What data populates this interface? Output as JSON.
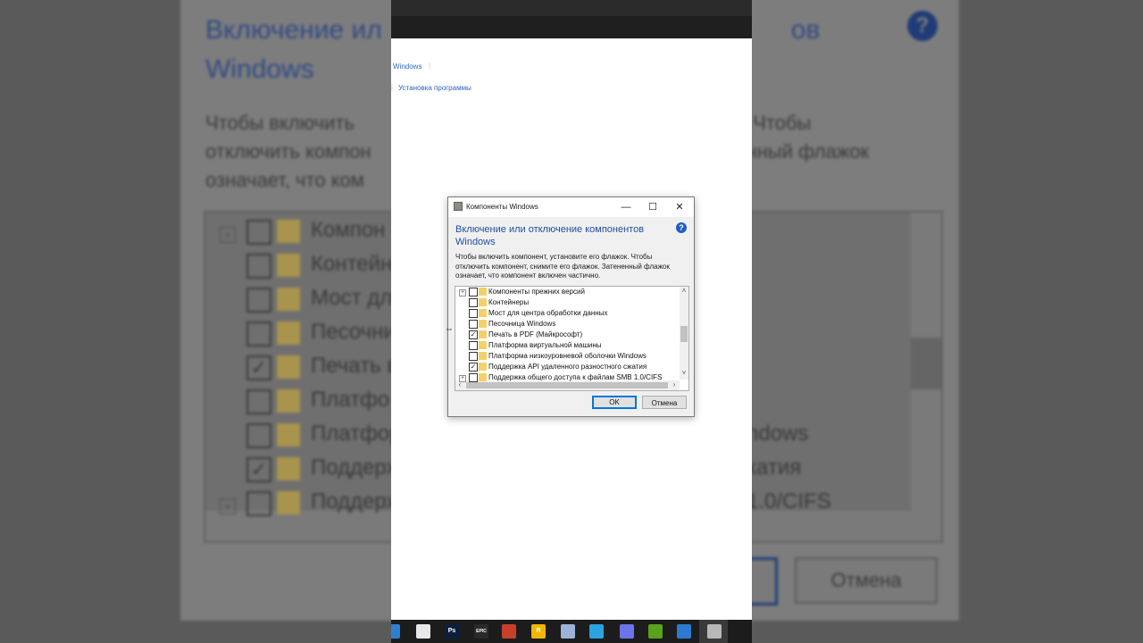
{
  "background": {
    "title": "Включение или отключение компонентов Windows",
    "title_left": "Включение ил",
    "title_right": "ов",
    "title_line2": "Windows",
    "desc_lines": [
      {
        "left": "Чтобы включить",
        "right": ". Чтобы"
      },
      {
        "left": "отключить компон",
        "right": "нный флажок"
      },
      {
        "left": "означает, что ком",
        "right": ""
      }
    ],
    "rows": [
      {
        "text_left": "Компон",
        "text_right": "",
        "checked": false,
        "expander": true
      },
      {
        "text_left": "Контейн",
        "text_right": "",
        "checked": false,
        "expander": false
      },
      {
        "text_left": "Мост дл",
        "text_right": "",
        "checked": false,
        "expander": false
      },
      {
        "text_left": "Песочни",
        "text_right": "",
        "checked": false,
        "expander": false
      },
      {
        "text_left": "Печать в",
        "text_right": "",
        "checked": true,
        "expander": false
      },
      {
        "text_left": "Платфо",
        "text_right": "",
        "checked": false,
        "expander": false
      },
      {
        "text_left": "Платфор",
        "text_right": "ndows",
        "checked": false,
        "expander": false
      },
      {
        "text_left": "Поддерж",
        "text_right": "катия",
        "checked": true,
        "expander": false
      },
      {
        "text_left": "Поддерж",
        "text_right": "1.0/CIFS",
        "checked": false,
        "expander": true
      }
    ],
    "cancel_label": "Отмена"
  },
  "breadcrumb": {
    "item1": "Windows",
    "item2": "Установка программы"
  },
  "dialog": {
    "window_title": "Компоненты Windows",
    "heading": "Включение или отключение компонентов Windows",
    "description": "Чтобы включить компонент, установите его флажок. Чтобы отключить компонент, снимите его флажок. Затененный флажок означает, что компонент включен частично.",
    "components": [
      {
        "label": "Компоненты прежних версий",
        "checked": false,
        "expander": true
      },
      {
        "label": "Контейнеры",
        "checked": false,
        "expander": false
      },
      {
        "label": "Мост для центра обработки данных",
        "checked": false,
        "expander": false
      },
      {
        "label": "Песочница Windows",
        "checked": false,
        "expander": false
      },
      {
        "label": "Печать в PDF (Майкрософт)",
        "checked": true,
        "expander": false
      },
      {
        "label": "Платформа виртуальной машины",
        "checked": false,
        "expander": false
      },
      {
        "label": "Платформа низкоуровневой оболочки Windows",
        "checked": false,
        "expander": false
      },
      {
        "label": "Поддержка API удаленного разностного сжатия",
        "checked": true,
        "expander": false
      },
      {
        "label": "Поддержка общего доступа к файлам SMB 1.0/CIFS",
        "checked": false,
        "expander": true
      }
    ],
    "ok_label": "OK",
    "cancel_label": "Отмена",
    "help_glyph": "?"
  },
  "taskbar": {
    "apps": [
      {
        "icon": "pen-icon",
        "glyph": "",
        "color": "#2d7fd3"
      },
      {
        "icon": "file-explorer-icon",
        "glyph": "",
        "color": "#e8e8e8"
      },
      {
        "icon": "photoshop-icon",
        "glyph": "Ps",
        "color": "#0a1f3d"
      },
      {
        "icon": "epic-games-icon",
        "glyph": "EPIC",
        "color": "#2a2a2a"
      },
      {
        "icon": "media-icon",
        "glyph": "",
        "color": "#c8402a"
      },
      {
        "icon": "rockstar-icon",
        "glyph": "R",
        "color": "#f2b700"
      },
      {
        "icon": "image-viewer-icon",
        "glyph": "",
        "color": "#9ab3d6"
      },
      {
        "icon": "telegram-icon",
        "glyph": "",
        "color": "#2aa3e0"
      },
      {
        "icon": "discord-icon",
        "glyph": "",
        "color": "#6b74e8"
      },
      {
        "icon": "nvidia-icon",
        "glyph": "",
        "color": "#5aa11c"
      },
      {
        "icon": "photos-icon",
        "glyph": "",
        "color": "#2c7bd0"
      },
      {
        "icon": "features-dialog-icon",
        "glyph": "",
        "color": "#b8b8b8"
      }
    ]
  }
}
